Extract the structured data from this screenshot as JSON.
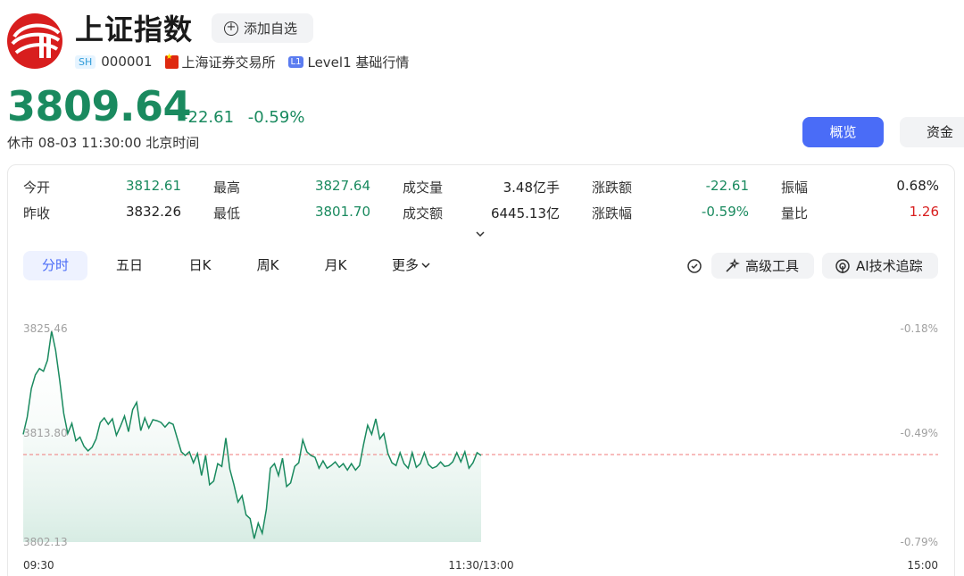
{
  "header": {
    "title": "上证指数",
    "watch_label": "添加自选",
    "market_badge": "SH",
    "code": "000001",
    "exchange": "上海证券交易所",
    "level_badge": "L1",
    "level_label": "Level1 基础行情"
  },
  "quote": {
    "price": "3809.64",
    "change": "-22.61",
    "change_pct": "-0.59%",
    "status": "休市 08-03 11:30:00 北京时间",
    "color_down": "#1a8a5f",
    "color_up": "#d81e1e"
  },
  "tabs": {
    "overview": "概览",
    "fund": "资金"
  },
  "stats": {
    "open_label": "今开",
    "open": "3812.61",
    "high_label": "最高",
    "high": "3827.64",
    "volume_label": "成交量",
    "volume": "3.48亿手",
    "chg_label": "涨跌额",
    "chg": "-22.61",
    "amp_label": "振幅",
    "amp": "0.68%",
    "prev_label": "昨收",
    "prev": "3832.26",
    "low_label": "最低",
    "low": "3801.70",
    "turnover_label": "成交额",
    "turnover": "6445.13亿",
    "chgpct_label": "涨跌幅",
    "chgpct": "-0.59%",
    "vr_label": "量比",
    "vr": "1.26"
  },
  "periods": [
    "分时",
    "五日",
    "日K",
    "周K",
    "月K",
    "更多"
  ],
  "tools": {
    "advanced": "高级工具",
    "ai": "AI技术追踪"
  },
  "chart_data": {
    "type": "line",
    "y_left_ticks": [
      "3825.46",
      "3813.80",
      "3802.13"
    ],
    "y_right_ticks": [
      "-0.18%",
      "-0.49%",
      "-0.79%"
    ],
    "x_ticks": [
      "09:30",
      "11:30/13:00",
      "15:00"
    ],
    "ylim": [
      3802.13,
      3825.46
    ],
    "reference_line": 3811.7,
    "y": [
      3813.9,
      3815.8,
      3818.9,
      3820.4,
      3821.1,
      3820.8,
      3822.0,
      3825.2,
      3823.1,
      3819.8,
      3816.2,
      3814.0,
      3815.1,
      3813.2,
      3813.6,
      3812.6,
      3812.1,
      3812.5,
      3813.4,
      3815.2,
      3815.7,
      3815.0,
      3815.6,
      3813.8,
      3814.8,
      3815.9,
      3814.2,
      3816.6,
      3817.4,
      3814.3,
      3815.7,
      3814.6,
      3815.5,
      3815.4,
      3815.2,
      3814.7,
      3815.2,
      3815.0,
      3813.5,
      3812.0,
      3811.6,
      3812.0,
      3810.8,
      3811.8,
      3809.4,
      3811.6,
      3808.4,
      3808.8,
      3810.7,
      3810.4,
      3813.5,
      3810.1,
      3808.4,
      3806.5,
      3807.2,
      3805.1,
      3804.7,
      3802.5,
      3804.2,
      3803.1,
      3805.7,
      3810.2,
      3810.7,
      3809.4,
      3811.3,
      3808.2,
      3808.6,
      3810.4,
      3810.8,
      3813.3,
      3812.0,
      3811.6,
      3811.4,
      3810.2,
      3811.0,
      3810.2,
      3810.5,
      3810.9,
      3810.3,
      3810.7,
      3810.0,
      3810.7,
      3810.0,
      3810.5,
      3812.8,
      3814.9,
      3813.9,
      3815.6,
      3813.4,
      3814.0,
      3811.8,
      3810.8,
      3810.5,
      3811.9,
      3810.7,
      3810.2,
      3811.9,
      3810.3,
      3810.7,
      3811.9,
      3810.6,
      3810.2,
      3810.4,
      3810.9,
      3810.4,
      3810.5,
      3810.9,
      3811.9,
      3810.9,
      3812.0,
      3810.2,
      3810.8,
      3811.9,
      3811.6
    ]
  }
}
